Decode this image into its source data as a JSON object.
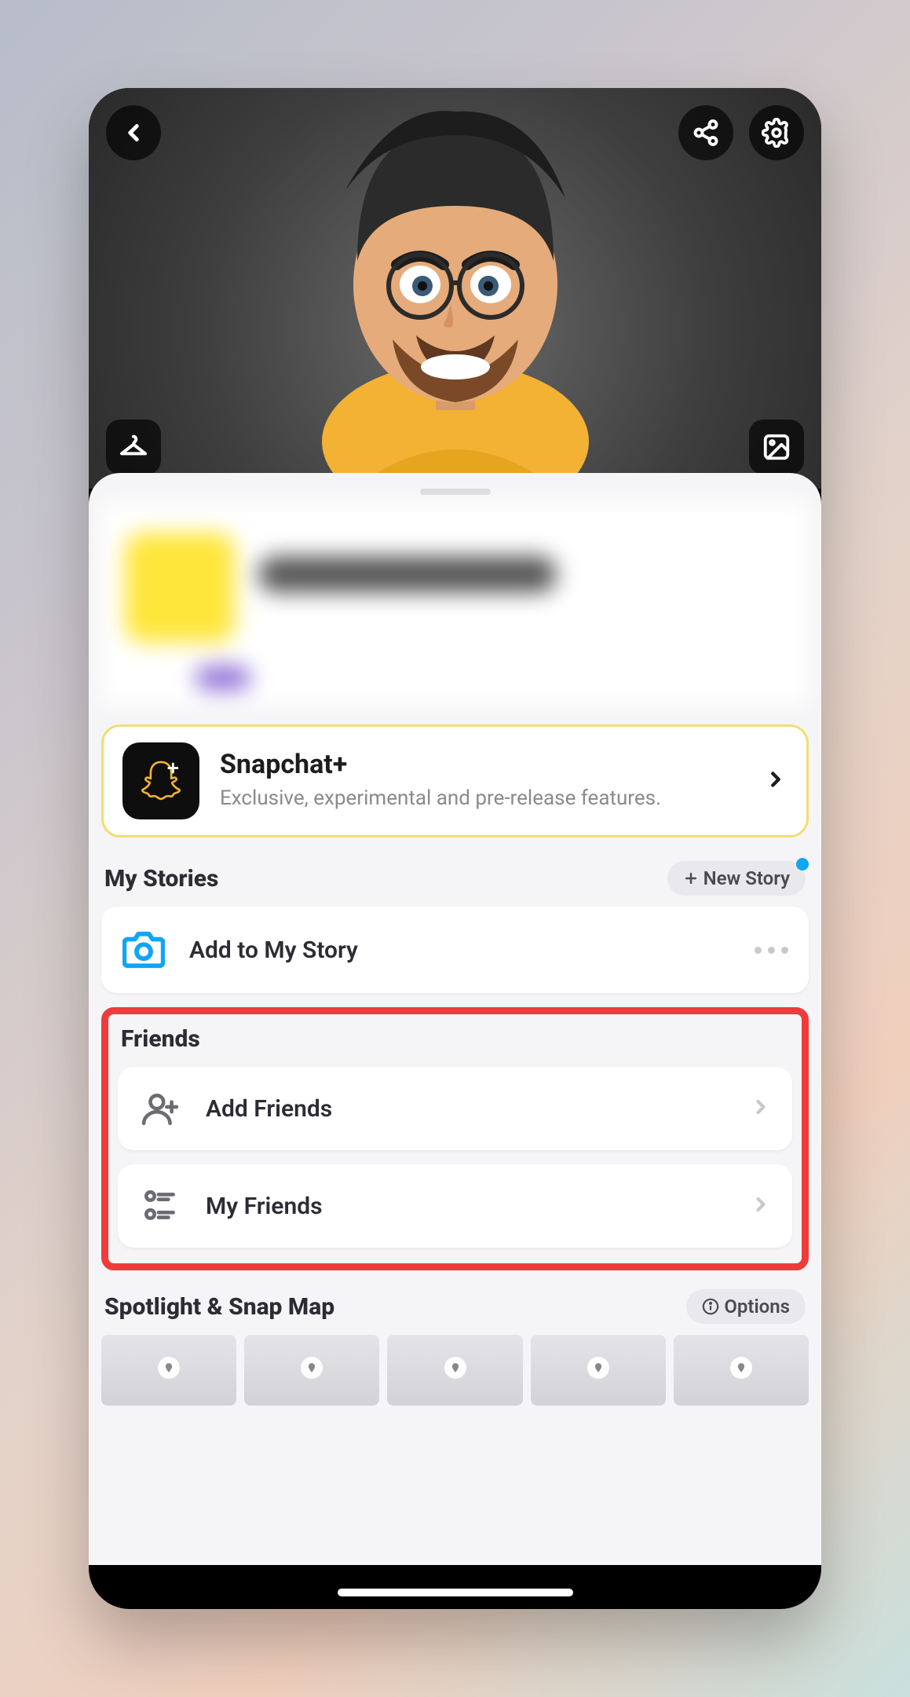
{
  "header": {
    "icons": {
      "back": "chevron-left-icon",
      "share": "share-icon",
      "settings": "gear-icon",
      "outfit": "hanger-icon",
      "background": "picture-icon"
    }
  },
  "snapchat_plus": {
    "title": "Snapchat+",
    "subtitle": "Exclusive, experimental and pre-release features."
  },
  "stories": {
    "title": "My Stories",
    "new_button": "New Story",
    "add_label": "Add to My Story"
  },
  "friends": {
    "title": "Friends",
    "add_label": "Add Friends",
    "my_label": "My Friends"
  },
  "spotlight": {
    "title": "Spotlight & Snap Map",
    "options_label": "Options"
  }
}
